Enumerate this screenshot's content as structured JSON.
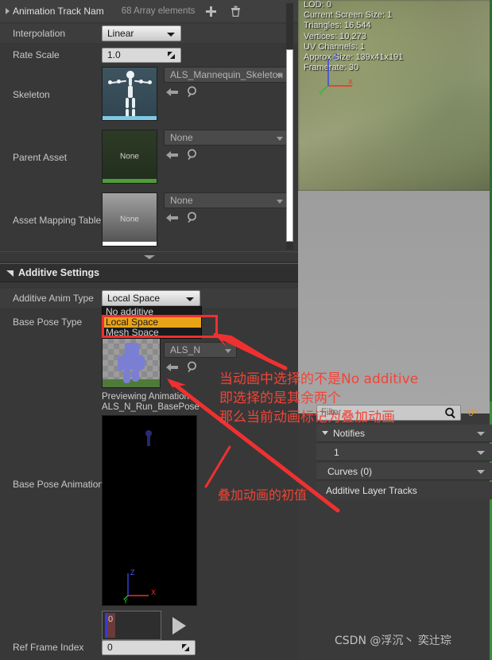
{
  "details": {
    "array_row": {
      "label": "Animation Track Nam",
      "count_text": "68 Array elements",
      "add_icon": "plus-icon",
      "delete_icon": "trash-icon"
    },
    "rows": [
      {
        "label": "Interpolation",
        "value": "Linear",
        "type": "combo"
      },
      {
        "label": "Rate Scale",
        "value": "1.0",
        "type": "number"
      },
      {
        "label": "Skeleton",
        "value": "ALS_Mannequin_Skeleton",
        "type": "asset"
      },
      {
        "label": "Parent Asset",
        "value": "None",
        "type": "asset"
      },
      {
        "label": "Asset Mapping Table",
        "value": "None",
        "type": "asset"
      }
    ],
    "thumb_none_label": "None",
    "section": {
      "title": "Additive Settings",
      "collapse_icon": "triangle-down-icon"
    },
    "additive_anim_type": {
      "label": "Additive Anim Type",
      "value": "Local Space",
      "options": [
        "No additive",
        "Local Space",
        "Mesh Space"
      ],
      "selected_index": 1
    },
    "base_pose_type": {
      "label": "Base Pose Type"
    },
    "base_pose_animation": {
      "label": "Base Pose Animation",
      "asset_value": "ALS_N",
      "previewing_line1": "Previewing Animation",
      "previewing_line2": "ALS_N_Run_BasePose",
      "time_value": "0"
    },
    "ref_frame_index": {
      "label": "Ref Frame Index",
      "value": "0"
    },
    "axis_labels": {
      "x": "X",
      "y": "Y",
      "z": "Z"
    }
  },
  "viewport": {
    "stats": [
      "LOD: 0",
      "Current Screen Size: 1",
      "Triangles: 16,544",
      "Vertices: 10,273",
      "UV Channels: 1",
      "Approx Size: 139x41x191",
      "Framerate: 30"
    ],
    "axis_labels": {
      "x": "X",
      "y": "Y",
      "z": "Z"
    }
  },
  "notifies_panel": {
    "filter_placeholder": "Filter",
    "search_icon": "magnifier-icon",
    "zero_label": "0*",
    "rows": [
      {
        "label": "Notifies",
        "caret": "chevron-down-icon",
        "expanded": true
      },
      {
        "label": "1",
        "caret": "chevron-down-icon",
        "expanded": false
      },
      {
        "label": "Curves  (0)",
        "caret": "chevron-down-icon",
        "expanded": false
      },
      {
        "label": "Additive Layer Tracks",
        "caret": "",
        "expanded": false
      }
    ]
  },
  "annotations": {
    "line1": "当动画中选择的不是No additive",
    "line2": "即选择的是其余两个",
    "line3": "那么当前动画标记为叠加动画",
    "line4": "叠加动画的初值"
  },
  "watermark": "CSDN @浮沉丶 奕辻琮",
  "colors": {
    "highlight_orange": "#e8a317",
    "annotation_red": "#f44336",
    "panel_bg": "#383838",
    "accent_green": "#2f6b2f"
  }
}
